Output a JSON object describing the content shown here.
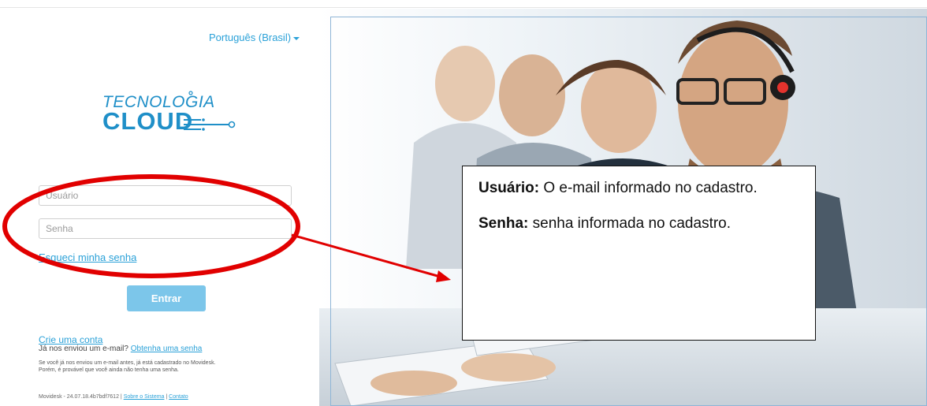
{
  "language_selector": {
    "label": "Português (Brasil)"
  },
  "logo": {
    "line1": "TECNOLOGIA",
    "line2": "CLOUD"
  },
  "login": {
    "user_placeholder": "Usuário",
    "password_placeholder": "Senha",
    "forgot_link": "Esqueci minha senha",
    "submit_label": "Entrar"
  },
  "signup": {
    "create_account": "Crie uma conta",
    "already_sent_text": "Já nos enviou um e-mail?",
    "get_password_link": "Obtenha uma senha",
    "note_line1": "Se você já nos enviou um e-mail antes, já está cadastrado no Movidesk.",
    "note_line2": "Porém, é provável que você ainda não tenha uma senha."
  },
  "footer": {
    "version": "Movidesk - 24.07.18.4b7bdf7612 |",
    "about_link": "Sobre o Sistema",
    "separator": "|",
    "contact_link": "Contato"
  },
  "callout": {
    "user_term": "Usuário:",
    "user_desc": " O e-mail informado no cadastro.",
    "pass_term": "Senha:",
    "pass_desc": " senha informada no cadastro."
  },
  "colors": {
    "accent": "#2aa1d8",
    "button": "#7cc6ea",
    "annotation": "#e10000"
  }
}
